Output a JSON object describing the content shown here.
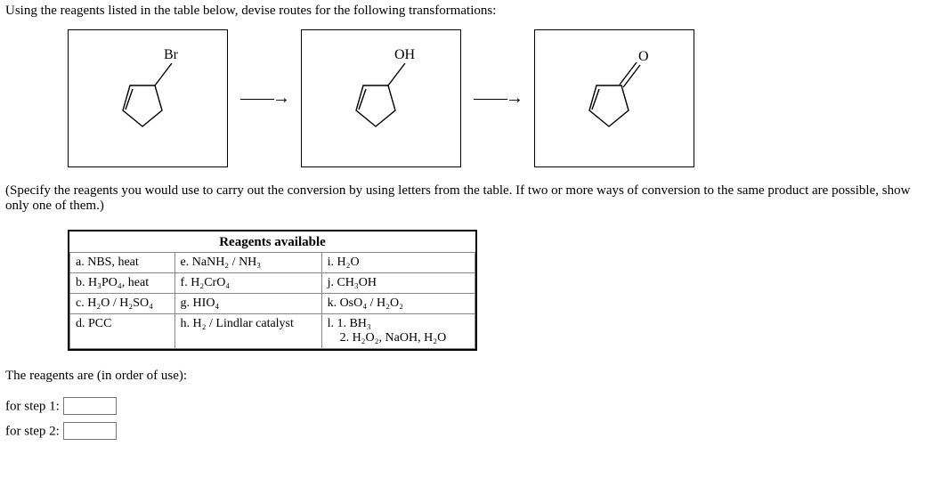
{
  "intro": "Using the reagents listed in the table below, devise routes for the following transformations:",
  "labels": {
    "br": "Br",
    "oh": "OH",
    "o": "O"
  },
  "arrow1": "——→",
  "arrow2": "——→",
  "note": "(Specify the reagents you would use to carry out the conversion by using letters from the table. If two or more ways of conversion to the same product are possible, show only one of them.)",
  "reagents_title": "Reagents available",
  "reagents": {
    "r0c0": "a. NBS, heat",
    "r0c1": "e. NaNH₂ / NH₃",
    "r0c2": "i. H₂O",
    "r1c0": "b. H₃PO₄, heat",
    "r1c1": "f. H₂CrO₄",
    "r1c2": "j. CH₃OH",
    "r2c0": "c. H₂O / H₂SO₄",
    "r2c1": "g. HIO₄",
    "r2c2": "k. OsO₄ / H₂O₂",
    "r3c0": "d. PCC",
    "r3c1": "h. H₂ / Lindlar catalyst",
    "r3c2": "l. 1. BH₃\n    2. H₂O₂, NaOH, H₂O"
  },
  "answer_intro": "The reagents are (in order of use):",
  "step1_label": "for step 1:",
  "step2_label": "for step 2:",
  "step1_value": "",
  "step2_value": ""
}
